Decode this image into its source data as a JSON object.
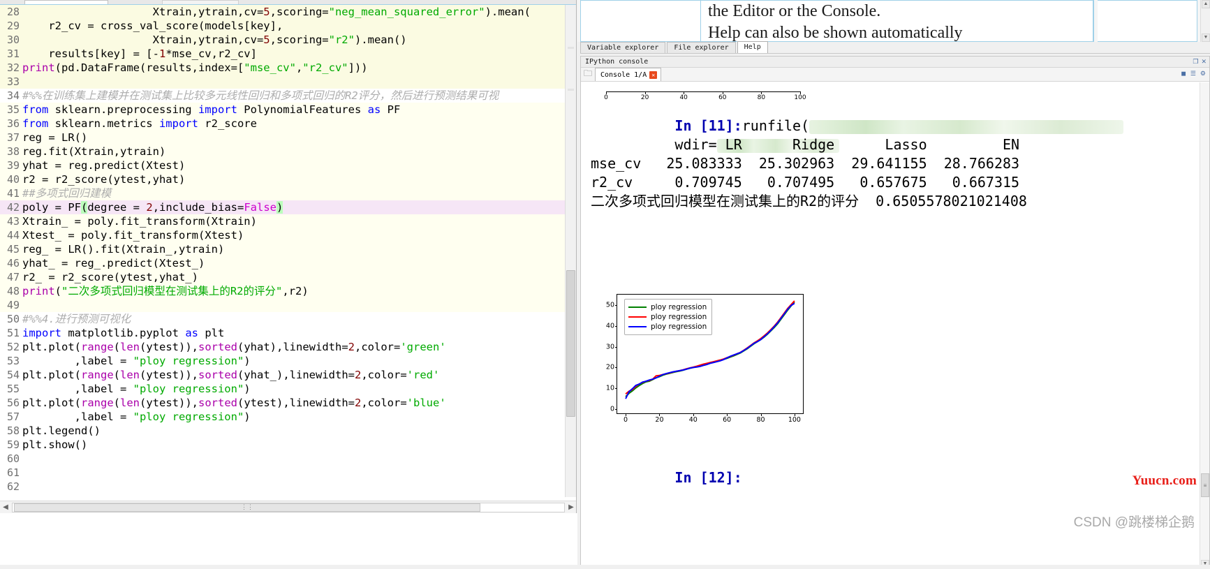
{
  "editor": {
    "name": "code-editor",
    "hscroll_grip": "⋮⋮",
    "lines": [
      {
        "n": "28",
        "indent": 0,
        "bg": "cell",
        "tokens": [
          {
            "t": "                    Xtrain,ytrain,cv=",
            "c": "plain"
          },
          {
            "t": "5",
            "c": "num"
          },
          {
            "t": ",scoring=",
            "c": "plain"
          },
          {
            "t": "\"neg_mean_squared_error\"",
            "c": "str"
          },
          {
            "t": ").mean(",
            "c": "plain"
          }
        ]
      },
      {
        "n": "29",
        "bg": "cell",
        "tokens": [
          {
            "t": "    r2_cv = cross_val_score(models[key],",
            "c": "plain"
          }
        ]
      },
      {
        "n": "30",
        "bg": "cell",
        "tokens": [
          {
            "t": "                    Xtrain,ytrain,cv=",
            "c": "plain"
          },
          {
            "t": "5",
            "c": "num"
          },
          {
            "t": ",scoring=",
            "c": "plain"
          },
          {
            "t": "\"r2\"",
            "c": "str"
          },
          {
            "t": ").mean()",
            "c": "plain"
          }
        ]
      },
      {
        "n": "31",
        "bg": "cell",
        "tokens": [
          {
            "t": "    results[key] = [-",
            "c": "plain"
          },
          {
            "t": "1",
            "c": "num"
          },
          {
            "t": "*mse_cv,r2_cv]",
            "c": "plain"
          }
        ]
      },
      {
        "n": "32",
        "bg": "cell",
        "tokens": [
          {
            "t": "print",
            "c": "fn"
          },
          {
            "t": "(pd.DataFrame(results,index=[",
            "c": "plain"
          },
          {
            "t": "\"mse_cv\"",
            "c": "str"
          },
          {
            "t": ",",
            "c": "plain"
          },
          {
            "t": "\"r2_cv\"",
            "c": "str"
          },
          {
            "t": "]))",
            "c": "plain"
          }
        ]
      },
      {
        "n": "33",
        "bg": "cell",
        "tokens": [
          {
            "t": "",
            "c": "plain"
          }
        ]
      },
      {
        "n": "34",
        "bg": "none",
        "tokens": [
          {
            "t": "#%%在训练集上建模并在测试集上比较多元线性回归和多项式回归的R2评分，然后进行预测结果可视",
            "c": "cmt"
          }
        ]
      },
      {
        "n": "35",
        "bg": "cell2",
        "tokens": [
          {
            "t": "from",
            "c": "kw"
          },
          {
            "t": " sklearn.preprocessing ",
            "c": "plain"
          },
          {
            "t": "import",
            "c": "kw"
          },
          {
            "t": " PolynomialFeatures ",
            "c": "plain"
          },
          {
            "t": "as",
            "c": "kw"
          },
          {
            "t": " PF",
            "c": "plain"
          }
        ]
      },
      {
        "n": "36",
        "bg": "cell2",
        "tokens": [
          {
            "t": "from",
            "c": "kw"
          },
          {
            "t": " sklearn.metrics ",
            "c": "plain"
          },
          {
            "t": "import",
            "c": "kw"
          },
          {
            "t": " r2_score",
            "c": "plain"
          }
        ]
      },
      {
        "n": "37",
        "bg": "cell2",
        "tokens": [
          {
            "t": "reg = LR()",
            "c": "plain"
          }
        ]
      },
      {
        "n": "38",
        "bg": "cell2",
        "tokens": [
          {
            "t": "reg.fit(Xtrain,ytrain)",
            "c": "plain"
          }
        ]
      },
      {
        "n": "39",
        "bg": "cell2",
        "tokens": [
          {
            "t": "yhat = reg.predict(Xtest)",
            "c": "plain"
          }
        ]
      },
      {
        "n": "40",
        "bg": "cell2",
        "tokens": [
          {
            "t": "r2 = r2_score(ytest,yhat)",
            "c": "plain"
          }
        ]
      },
      {
        "n": "41",
        "bg": "cell2",
        "tokens": [
          {
            "t": "##多项式回归建模",
            "c": "cmt"
          }
        ]
      },
      {
        "n": "42",
        "bg": "cur",
        "tokens": [
          {
            "t": "poly = PF",
            "c": "plain"
          },
          {
            "t": "(",
            "c": "paren"
          },
          {
            "t": "degree = ",
            "c": "plain"
          },
          {
            "t": "2",
            "c": "num"
          },
          {
            "t": ",include_bias=",
            "c": "plain"
          },
          {
            "t": "False",
            "c": "pink"
          },
          {
            "t": ")",
            "c": "paren"
          }
        ]
      },
      {
        "n": "43",
        "bg": "cell2",
        "tokens": [
          {
            "t": "Xtrain_ = poly.fit_transform(Xtrain)",
            "c": "plain"
          }
        ]
      },
      {
        "n": "44",
        "bg": "cell2",
        "tokens": [
          {
            "t": "Xtest_ = poly.fit_transform(Xtest)",
            "c": "plain"
          }
        ]
      },
      {
        "n": "45",
        "bg": "cell2",
        "tokens": [
          {
            "t": "reg_ = LR().fit(Xtrain_,ytrain)",
            "c": "plain"
          }
        ]
      },
      {
        "n": "46",
        "bg": "cell2",
        "tokens": [
          {
            "t": "yhat_ = reg_.predict(Xtest_)",
            "c": "plain"
          }
        ]
      },
      {
        "n": "47",
        "bg": "cell2",
        "tokens": [
          {
            "t": "r2_ = r2_score(ytest,yhat_)",
            "c": "plain"
          }
        ]
      },
      {
        "n": "48",
        "bg": "cell2",
        "tokens": [
          {
            "t": "print",
            "c": "fn"
          },
          {
            "t": "(",
            "c": "plain"
          },
          {
            "t": "\"二次多项式回归模型在测试集上的R2的评分\"",
            "c": "str"
          },
          {
            "t": ",r2)",
            "c": "plain"
          }
        ]
      },
      {
        "n": "49",
        "bg": "cell2",
        "tokens": [
          {
            "t": "",
            "c": "plain"
          }
        ]
      },
      {
        "n": "50",
        "bg": "none",
        "tokens": [
          {
            "t": "#%%4.进行预测可视化",
            "c": "cmt"
          }
        ]
      },
      {
        "n": "51",
        "bg": "none",
        "tokens": [
          {
            "t": "import",
            "c": "kw"
          },
          {
            "t": " matplotlib.pyplot ",
            "c": "plain"
          },
          {
            "t": "as",
            "c": "kw"
          },
          {
            "t": " plt",
            "c": "plain"
          }
        ]
      },
      {
        "n": "52",
        "bg": "none",
        "tokens": [
          {
            "t": "plt.plot(",
            "c": "plain"
          },
          {
            "t": "range",
            "c": "fn"
          },
          {
            "t": "(",
            "c": "plain"
          },
          {
            "t": "len",
            "c": "fn"
          },
          {
            "t": "(ytest)),",
            "c": "plain"
          },
          {
            "t": "sorted",
            "c": "fn"
          },
          {
            "t": "(yhat),linewidth=",
            "c": "plain"
          },
          {
            "t": "2",
            "c": "num"
          },
          {
            "t": ",color=",
            "c": "plain"
          },
          {
            "t": "'green'",
            "c": "str"
          }
        ]
      },
      {
        "n": "53",
        "bg": "none",
        "tokens": [
          {
            "t": "        ,label = ",
            "c": "plain"
          },
          {
            "t": "\"ploy regression\"",
            "c": "str"
          },
          {
            "t": ")",
            "c": "plain"
          }
        ]
      },
      {
        "n": "54",
        "bg": "none",
        "tokens": [
          {
            "t": "plt.plot(",
            "c": "plain"
          },
          {
            "t": "range",
            "c": "fn"
          },
          {
            "t": "(",
            "c": "plain"
          },
          {
            "t": "len",
            "c": "fn"
          },
          {
            "t": "(ytest)),",
            "c": "plain"
          },
          {
            "t": "sorted",
            "c": "fn"
          },
          {
            "t": "(yhat_),linewidth=",
            "c": "plain"
          },
          {
            "t": "2",
            "c": "num"
          },
          {
            "t": ",color=",
            "c": "plain"
          },
          {
            "t": "'red'",
            "c": "str"
          }
        ]
      },
      {
        "n": "55",
        "bg": "none",
        "tokens": [
          {
            "t": "        ,label = ",
            "c": "plain"
          },
          {
            "t": "\"ploy regression\"",
            "c": "str"
          },
          {
            "t": ")",
            "c": "plain"
          }
        ]
      },
      {
        "n": "56",
        "bg": "none",
        "tokens": [
          {
            "t": "plt.plot(",
            "c": "plain"
          },
          {
            "t": "range",
            "c": "fn"
          },
          {
            "t": "(",
            "c": "plain"
          },
          {
            "t": "len",
            "c": "fn"
          },
          {
            "t": "(ytest)),",
            "c": "plain"
          },
          {
            "t": "sorted",
            "c": "fn"
          },
          {
            "t": "(ytest),linewidth=",
            "c": "plain"
          },
          {
            "t": "2",
            "c": "num"
          },
          {
            "t": ",color=",
            "c": "plain"
          },
          {
            "t": "'blue'",
            "c": "str"
          }
        ]
      },
      {
        "n": "57",
        "bg": "none",
        "tokens": [
          {
            "t": "        ,label = ",
            "c": "plain"
          },
          {
            "t": "\"ploy regression\"",
            "c": "str"
          },
          {
            "t": ")",
            "c": "plain"
          }
        ]
      },
      {
        "n": "58",
        "bg": "none",
        "tokens": [
          {
            "t": "plt.legend()",
            "c": "plain"
          }
        ]
      },
      {
        "n": "59",
        "bg": "none",
        "tokens": [
          {
            "t": "plt.show()",
            "c": "plain"
          }
        ]
      },
      {
        "n": "60",
        "bg": "none",
        "tokens": [
          {
            "t": "",
            "c": "plain"
          }
        ]
      },
      {
        "n": "61",
        "bg": "none",
        "tokens": [
          {
            "t": "",
            "c": "plain"
          }
        ]
      },
      {
        "n": "62",
        "bg": "none",
        "tokens": [
          {
            "t": "",
            "c": "plain"
          }
        ]
      }
    ]
  },
  "help": {
    "line1": "the Editor or the Console.",
    "line2": "Help can also be shown automatically"
  },
  "dock_tabs": [
    {
      "label": "Variable explorer",
      "active": false
    },
    {
      "label": "File explorer",
      "active": false
    },
    {
      "label": "Help",
      "active": true
    }
  ],
  "console": {
    "panel_title": "IPython console",
    "tab_label": "Console 1/A",
    "tab_close": "✕",
    "folder_icon": "folder-icon",
    "prompt_in_11": "In [11]:",
    "runfile_text": "runfile(",
    "wdir_text": "wdir=",
    "table": {
      "columns": [
        "LR",
        "Ridge",
        "Lasso",
        "EN"
      ],
      "rows": [
        {
          "name": "mse_cv",
          "values": [
            "25.083333",
            "25.302963",
            "29.641155",
            "28.766283"
          ]
        },
        {
          "name": "r2_cv",
          "values": [
            "0.709745",
            "0.707495",
            "0.657675",
            "0.667315"
          ]
        }
      ]
    },
    "result_line": "二次多项式回归模型在测试集上的R2的评分  0.6505578021021408",
    "prompt_in_12": "In [12]:"
  },
  "chart_data": {
    "type": "line",
    "title": "",
    "xlabel": "",
    "ylabel": "",
    "xlim": [
      -5,
      105
    ],
    "ylim": [
      -2,
      55
    ],
    "xticks": [
      0,
      20,
      40,
      60,
      80,
      100
    ],
    "yticks": [
      0,
      10,
      20,
      30,
      40,
      50
    ],
    "grid": false,
    "legend_position": "upper left",
    "series": [
      {
        "name": "ploy regression",
        "color": "#008000",
        "linewidth": 2,
        "x": [
          0,
          2,
          4,
          6,
          8,
          10,
          12,
          14,
          16,
          18,
          20,
          22,
          24,
          26,
          28,
          30,
          32,
          34,
          36,
          38,
          40,
          42,
          44,
          46,
          48,
          50,
          52,
          54,
          56,
          58,
          60,
          62,
          64,
          66,
          68,
          70,
          72,
          74,
          76,
          78,
          80,
          82,
          84,
          86,
          88,
          90,
          92,
          94,
          96,
          98,
          100
        ],
        "values": [
          6.0,
          7.6,
          8.8,
          10.2,
          11.3,
          12.3,
          13.1,
          13.4,
          14.2,
          15.1,
          15.6,
          16.3,
          16.8,
          17.2,
          17.6,
          18.0,
          18.3,
          18.7,
          19.2,
          19.6,
          20.0,
          20.4,
          20.8,
          21.3,
          21.8,
          22.2,
          22.6,
          22.9,
          23.4,
          23.9,
          24.4,
          25.0,
          25.6,
          26.3,
          27.0,
          28.0,
          29.0,
          30.2,
          31.4,
          32.4,
          33.4,
          34.6,
          36.0,
          37.6,
          39.2,
          41.0,
          43.2,
          45.4,
          47.6,
          49.6,
          51.4
        ]
      },
      {
        "name": "ploy regression",
        "color": "#ff0000",
        "linewidth": 2,
        "x": [
          0,
          2,
          4,
          6,
          8,
          10,
          12,
          14,
          16,
          18,
          20,
          22,
          24,
          26,
          28,
          30,
          32,
          34,
          36,
          38,
          40,
          42,
          44,
          46,
          48,
          50,
          52,
          54,
          56,
          58,
          60,
          62,
          64,
          66,
          68,
          70,
          72,
          74,
          76,
          78,
          80,
          82,
          84,
          86,
          88,
          90,
          92,
          94,
          96,
          98,
          100
        ],
        "values": [
          7.3,
          8.6,
          9.4,
          10.9,
          12.1,
          12.8,
          13.4,
          13.8,
          14.4,
          16.0,
          16.2,
          16.6,
          17.0,
          17.4,
          17.8,
          18.2,
          18.5,
          18.9,
          19.4,
          19.8,
          20.2,
          20.6,
          21.1,
          21.6,
          22.0,
          22.4,
          22.8,
          23.2,
          23.6,
          24.1,
          24.7,
          25.3,
          25.9,
          26.6,
          27.3,
          28.3,
          29.4,
          30.6,
          31.8,
          32.8,
          33.9,
          35.2,
          36.6,
          38.2,
          39.9,
          41.8,
          44.0,
          46.2,
          48.4,
          50.2,
          52.0
        ]
      },
      {
        "name": "ploy regression",
        "color": "#0000ff",
        "linewidth": 2,
        "x": [
          0,
          2,
          4,
          6,
          8,
          10,
          12,
          14,
          16,
          18,
          20,
          22,
          24,
          26,
          28,
          30,
          32,
          34,
          36,
          38,
          40,
          42,
          44,
          46,
          48,
          50,
          52,
          54,
          56,
          58,
          60,
          62,
          64,
          66,
          68,
          70,
          72,
          74,
          76,
          78,
          80,
          82,
          84,
          86,
          88,
          90,
          92,
          94,
          96,
          98,
          100
        ],
        "values": [
          5.0,
          8.4,
          9.8,
          11.4,
          12.0,
          13.0,
          13.4,
          14.0,
          14.4,
          15.0,
          15.8,
          16.6,
          17.1,
          17.5,
          17.9,
          18.2,
          18.5,
          18.8,
          19.2,
          19.7,
          20.0,
          20.2,
          20.5,
          21.0,
          21.4,
          22.0,
          22.4,
          22.8,
          23.2,
          23.8,
          24.6,
          25.4,
          26.0,
          26.6,
          27.2,
          28.2,
          29.2,
          30.4,
          31.6,
          32.4,
          33.4,
          34.8,
          36.2,
          37.8,
          39.6,
          41.4,
          43.6,
          45.8,
          48.0,
          49.8,
          50.8
        ]
      }
    ],
    "top_partial_axis": {
      "ticks": [
        0,
        20,
        40,
        60,
        80,
        100
      ]
    }
  },
  "watermarks": {
    "yuucn": "Yuucn.com",
    "csdn": "CSDN @跳楼梯企鹅"
  },
  "colors": {
    "green": "#008000",
    "red": "#ff0000",
    "blue": "#0000ff",
    "prompt_blue": "#0000b0",
    "watermark_red": "#e8201a",
    "watermark_grey": "#a9a9a9"
  }
}
